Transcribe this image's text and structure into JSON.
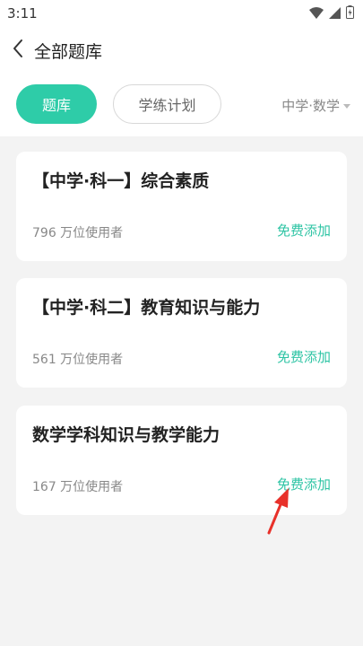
{
  "status_bar": {
    "time": "3:11",
    "icons": [
      "wifi-icon",
      "signal-icon",
      "battery-icon"
    ]
  },
  "header": {
    "back_icon": "chevron-left-icon",
    "title": "全部题库"
  },
  "tabs": {
    "active_label": "题库",
    "inactive_label": "学练计划",
    "filter_label": "中学·数学",
    "filter_icon": "caret-down-icon",
    "accent_color": "#2ecca8"
  },
  "cards": [
    {
      "title": "【中学·科一】综合素质",
      "users": "796 万位使用者",
      "action": "免费添加"
    },
    {
      "title": "【中学·科二】教育知识与能力",
      "users": "561 万位使用者",
      "action": "免费添加"
    },
    {
      "title": "数学学科知识与教学能力",
      "users": "167 万位使用者",
      "action": "免费添加"
    }
  ],
  "annotation": {
    "icon": "red-arrow-icon",
    "color": "#e8312a"
  }
}
